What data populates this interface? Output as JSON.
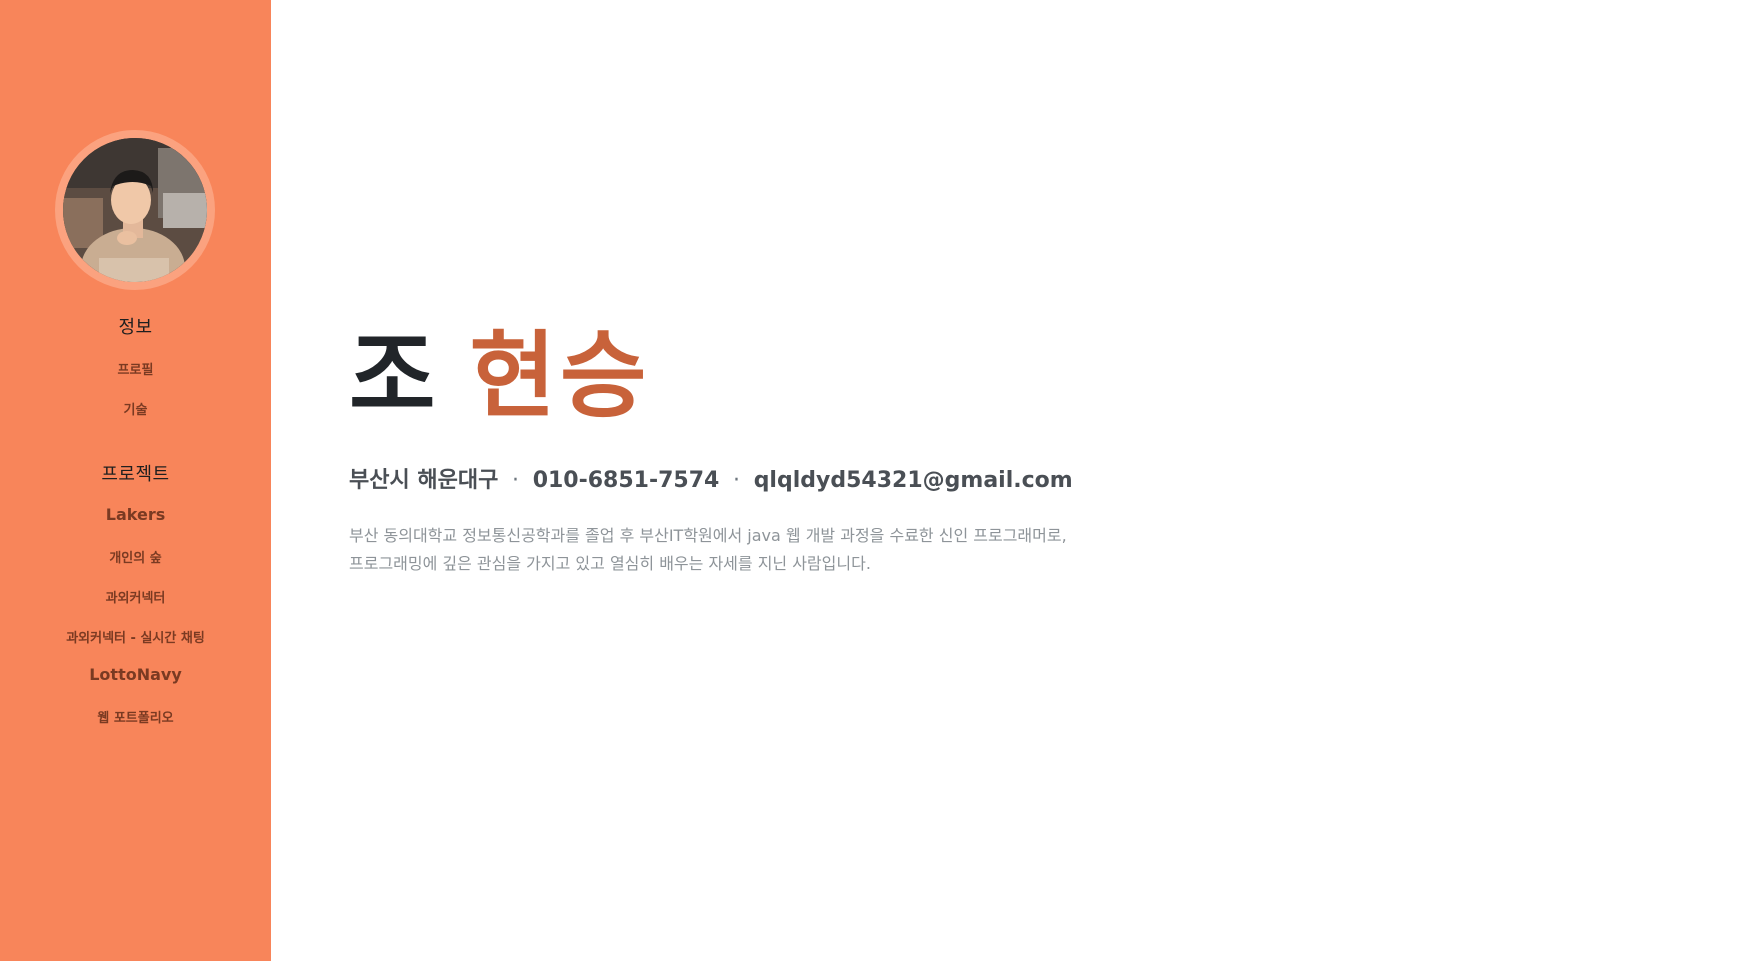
{
  "sidebar": {
    "sections": [
      {
        "heading": "정보",
        "items": [
          "프로필",
          "기술"
        ]
      },
      {
        "heading": "프로젝트",
        "items": [
          "Lakers",
          "개인의 숲",
          "과외커넥터",
          "과외커넥터 - 실시간 채팅",
          "LottoNavy",
          "웹 포트폴리오"
        ]
      }
    ]
  },
  "main": {
    "first_name": "조",
    "last_name": "현승",
    "contact": {
      "address": "부산시 해운대구",
      "separator": "·",
      "phone": "010-6851-7574",
      "email": "qlqldyd54321@gmail.com"
    },
    "description": [
      "부산 동의대학교 정보통신공학과를 졸업 후 부산IT학원에서 java 웹 개발 과정을 수료한 신인 프로그래머로,",
      "프로그래밍에 깊은 관심을 가지고 있고 열심히 배우는 자세를 지닌 사람입니다."
    ]
  },
  "colors": {
    "sidebar_bg": "#f8855a",
    "accent": "#c8623a",
    "name_dark": "#212529",
    "muted_text": "#8e9499"
  },
  "icons": {
    "avatar": "profile-photo"
  }
}
